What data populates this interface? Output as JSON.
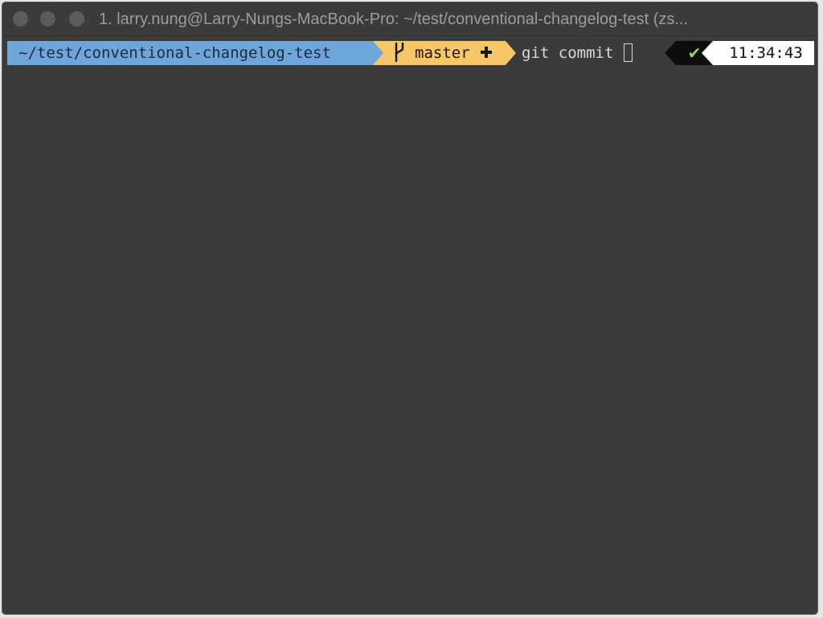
{
  "window": {
    "title": "1. larry.nung@Larry-Nungs-MacBook-Pro: ~/test/conventional-changelog-test (zs..."
  },
  "prompt": {
    "path": "~/test/conventional-changelog-test",
    "branch": "master",
    "branch_icon": "git-branch-icon",
    "dirty_icon": "plus-icon",
    "command": "git commit",
    "status_glyph": "✔",
    "time": "11:34:43"
  },
  "colors": {
    "path_bg": "#6ea6db",
    "git_bg": "#f7c667",
    "terminal_bg": "#3b3b3a",
    "status_ok": "#8fd16d"
  }
}
